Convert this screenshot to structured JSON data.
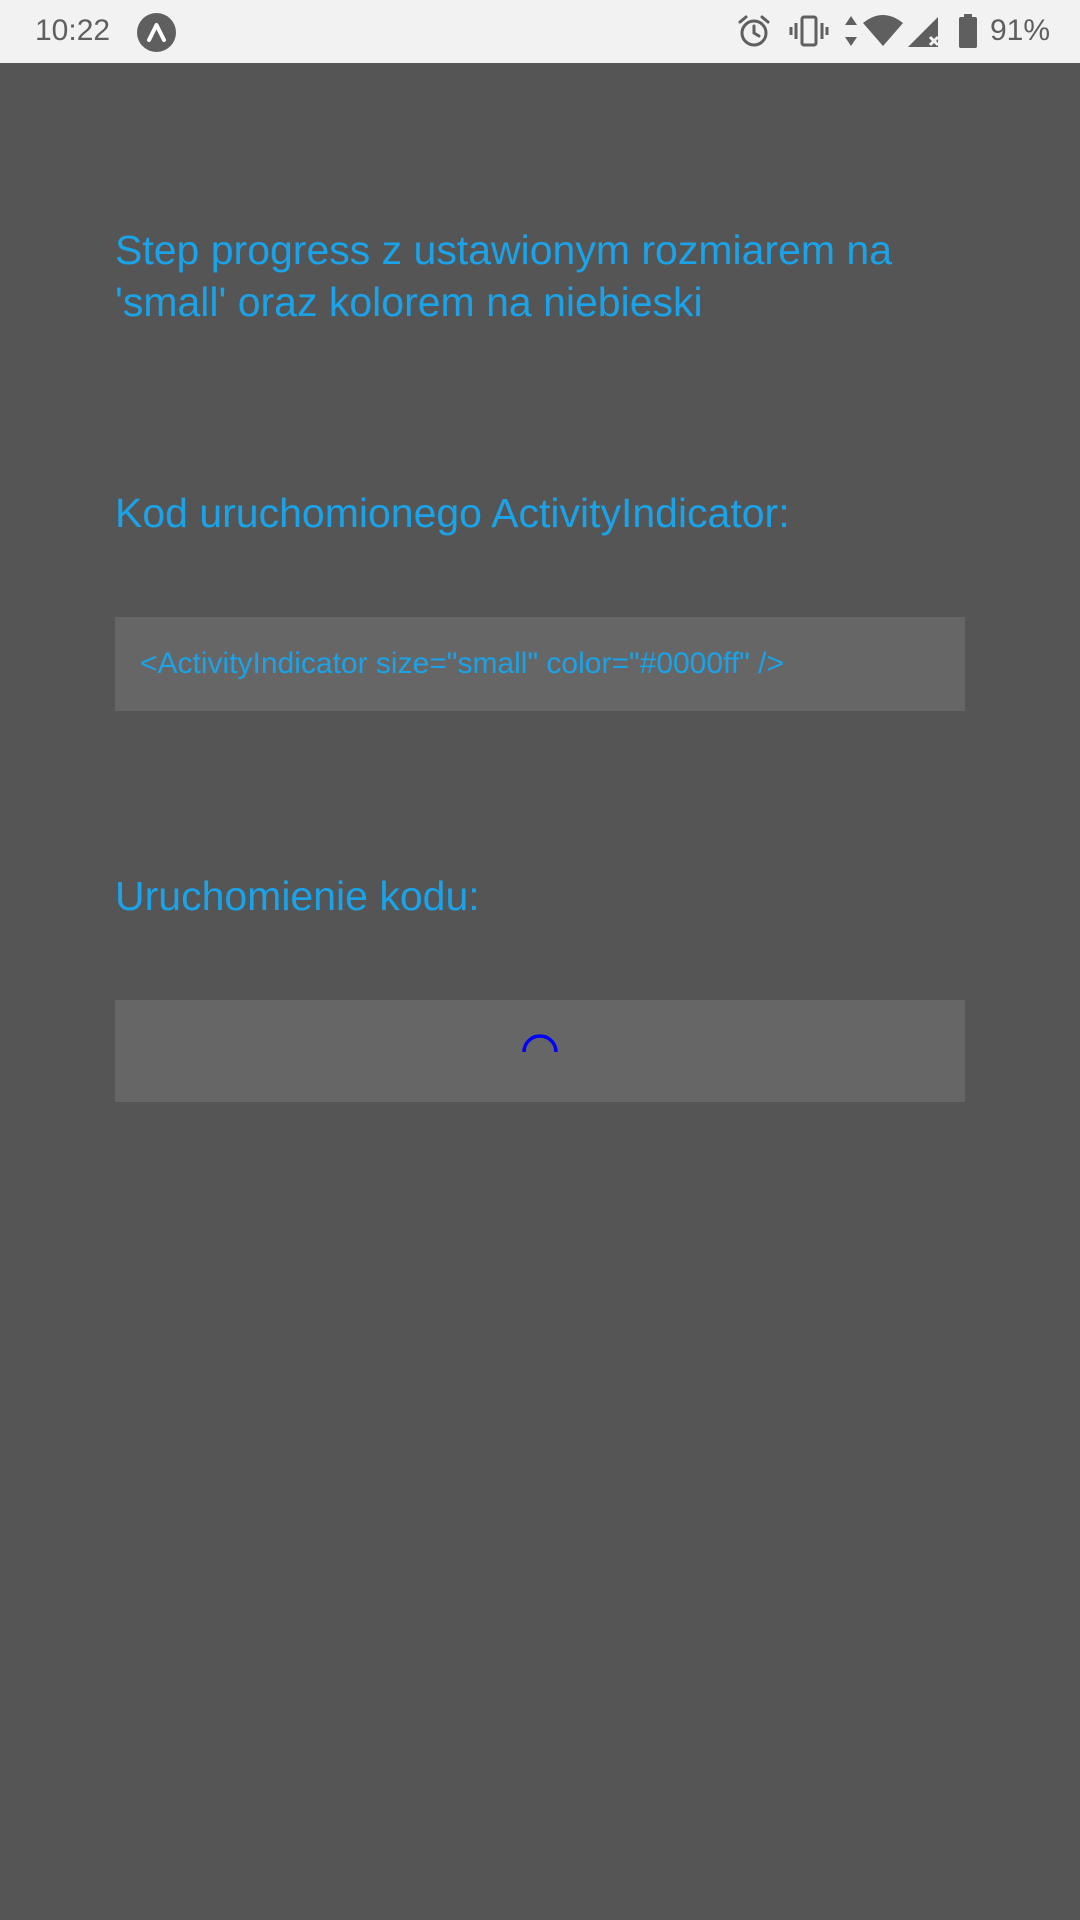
{
  "status_bar": {
    "time": "10:22",
    "battery": "91%",
    "icons": [
      "app-badge-icon",
      "alarm-icon",
      "vibrate-icon",
      "data-arrows-icon",
      "wifi-icon",
      "signal-icon",
      "battery-icon"
    ]
  },
  "main": {
    "title": "Step progress z ustawionym rozmiarem na 'small' oraz kolorem na niebieski",
    "code_heading": "Kod uruchomionego ActivityIndicator:",
    "code_snippet": "<ActivityIndicator size=\"small\" color=\"#0000ff\" />",
    "run_heading": "Uruchomienie kodu:",
    "spinner_color": "#0000ff"
  },
  "colors": {
    "accent": "#1aa3e8",
    "background": "#555555",
    "panel": "#666666",
    "status_bar": "#f2f2f2"
  }
}
